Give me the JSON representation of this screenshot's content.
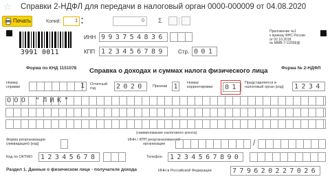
{
  "window": {
    "title": "Справки 2-НДФЛ для передачи в налоговый орган 0000-000009 от 04.08.2020"
  },
  "toolbar": {
    "print_label": "Печать",
    "copies_label": "Копий:",
    "copies_value": "1",
    "counter_value": "0",
    "sum_symbol": "Σ"
  },
  "barcode": {
    "number": "3991 0011"
  },
  "header": {
    "inn_label": "ИНН",
    "inn_value": "993754836",
    "kpp_label": "КПП",
    "kpp_value": "123456789",
    "page_label": "Стр.",
    "page_value": "001",
    "appendix": "Приложение №1\nк приказу ФНС России\nот 02.10.2018\n№ ММВ-7-11/566@",
    "form_knd": "Форма по КНД 1151078",
    "form_no": "Форма № 2-НДФЛ",
    "title": "Справка о доходах и суммах налога физического лица"
  },
  "fields": {
    "cert_no_label": "Номер\nсправки",
    "cert_no_value": "1",
    "year_label": "Отчетный\nгод",
    "year_value": "2020",
    "sign_label": "Признак",
    "sign_value": "1",
    "corr_label": "Номер\nкорректировки",
    "corr_value": "01",
    "tax_org_label": "Представляется в\nналоговый орган (код)",
    "tax_org_value": "1234",
    "agent_name": "ООО \"ЛИК\"",
    "agent_caption": "(наименование налогового агента)",
    "reorg_form_label": "Форма реорганизации\n(ликвидация) (код)",
    "reorg_inn_label": "ИНН / КПП реорганизованной\nорганизации",
    "oktmo_label": "Код по ОКТМО",
    "oktmo_value": "12345678",
    "phone_label": "Телефон",
    "phone_value": "1234567890",
    "section1": "Раздел 1. Данные о физическом лице - получателе дохода",
    "person_inn_label": "ИНН в Российской Федерации",
    "person_inn_value": "779620227026"
  },
  "colors": {
    "accent": "#e8c50c",
    "highlight": "#d43a3a"
  }
}
